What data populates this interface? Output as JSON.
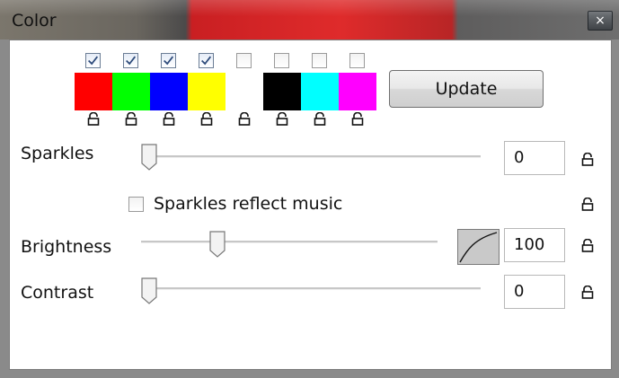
{
  "window": {
    "title": "Color",
    "close_glyph": "×"
  },
  "palette": {
    "swatches": [
      {
        "color": "#ff0000",
        "checked": true
      },
      {
        "color": "#00ff00",
        "checked": true
      },
      {
        "color": "#0000ff",
        "checked": true
      },
      {
        "color": "#ffff00",
        "checked": true
      },
      {
        "color": "#ffffff",
        "checked": false
      },
      {
        "color": "#000000",
        "checked": false
      },
      {
        "color": "#00ffff",
        "checked": false
      },
      {
        "color": "#ff00ff",
        "checked": false
      }
    ],
    "update_label": "Update"
  },
  "sparkles": {
    "label": "Sparkles",
    "value": "0",
    "slider_level": 0
  },
  "sparkles_reflect": {
    "label": "Sparkles reflect music",
    "checked": false
  },
  "brightness": {
    "label": "Brightness",
    "value": "100",
    "slider_level": 0.25
  },
  "contrast": {
    "label": "Contrast",
    "value": "0",
    "slider_level": 0
  },
  "icons": {
    "lock": "lock-icon",
    "check": "checkmark-icon",
    "curve": "curve-icon",
    "close": "close-icon"
  }
}
